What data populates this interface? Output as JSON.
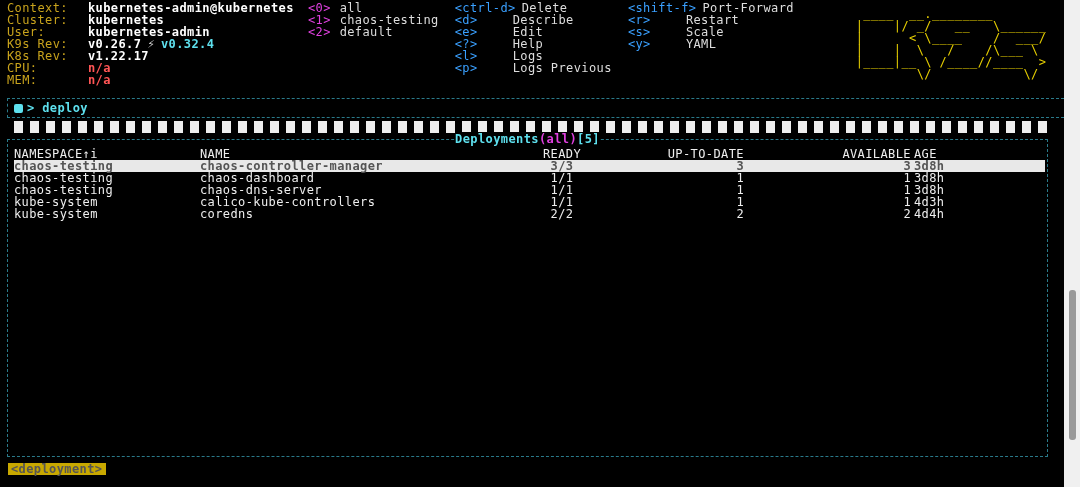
{
  "info": [
    {
      "label": "Context:",
      "value": "kubernetes-admin@kubernetes",
      "kind": "plain"
    },
    {
      "label": "Cluster:",
      "value": "kubernetes",
      "kind": "plain"
    },
    {
      "label": "User:",
      "value": "kubernetes-admin",
      "kind": "plain"
    },
    {
      "label": "K9s Rev:",
      "value": "v0.26.7",
      "upgrade_mark": "⚡",
      "upgrade": "v0.32.4",
      "kind": "plain"
    },
    {
      "label": "K8s Rev:",
      "value": "v1.22.17",
      "kind": "plain"
    },
    {
      "label": "CPU:",
      "value": "n/a",
      "kind": "warn"
    },
    {
      "label": "MEM:",
      "value": "n/a",
      "kind": "warn"
    }
  ],
  "namespaces": [
    {
      "key": "<0>",
      "name": "all"
    },
    {
      "key": "<1>",
      "name": "chaos-testing"
    },
    {
      "key": "<2>",
      "name": "default"
    }
  ],
  "shortcut_columns": [
    [
      {
        "key": "<ctrl-d>",
        "action": "Delete"
      },
      {
        "key": "<d>",
        "action": "Describe"
      },
      {
        "key": "<e>",
        "action": "Edit"
      },
      {
        "key": "<?>",
        "action": "Help"
      },
      {
        "key": "<l>",
        "action": "Logs"
      },
      {
        "key": "<p>",
        "action": "Logs Previous"
      }
    ],
    [
      {
        "key": "<shift-f>",
        "action": "Port-Forward"
      },
      {
        "key": "<r>",
        "action": "Restart"
      },
      {
        "key": "<s>",
        "action": "Scale"
      },
      {
        "key": "<y>",
        "action": "YAML"
      }
    ]
  ],
  "logo_lines": [
    " ____  __.________       ",
    "|    |/ _/   __   \\______ ",
    "|      < \\____    /  ___/ ",
    "|    |  \\   /    /\\___ \\  ",
    "|____|__ \\ /____//____  > ",
    "        \\/            \\/  "
  ],
  "command": {
    "prompt": ">",
    "value": "deploy"
  },
  "table": {
    "title": "Deployments",
    "scope": "(all)",
    "count": "[5]",
    "columns": [
      "NAMESPACE↑i",
      "NAME",
      "READY",
      "UP-TO-DATE",
      "AVAILABLE",
      "AGE"
    ],
    "rows": [
      {
        "cells": [
          "chaos-testing",
          "chaos-controller-manager",
          "3/3",
          "3",
          "3",
          "3d8h"
        ],
        "selected": true
      },
      {
        "cells": [
          "chaos-testing",
          "chaos-dashboard",
          "1/1",
          "1",
          "1",
          "3d8h"
        ],
        "selected": false
      },
      {
        "cells": [
          "chaos-testing",
          "chaos-dns-server",
          "1/1",
          "1",
          "1",
          "3d8h"
        ],
        "selected": false
      },
      {
        "cells": [
          "kube-system",
          "calico-kube-controllers",
          "1/1",
          "1",
          "1",
          "4d3h"
        ],
        "selected": false
      },
      {
        "cells": [
          "kube-system",
          "coredns",
          "2/2",
          "2",
          "2",
          "4d4h"
        ],
        "selected": false
      }
    ]
  },
  "crumbs": [
    {
      "label": "<deployment>",
      "selected": true
    }
  ]
}
